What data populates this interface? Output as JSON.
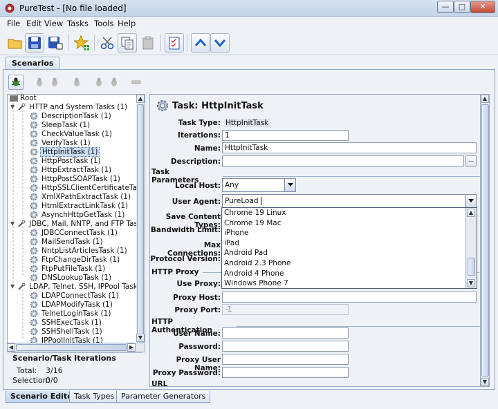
{
  "window": {
    "title": "PureTest - [No file loaded]"
  },
  "menu": [
    "File",
    "Edit",
    "View",
    "Tasks",
    "Tools",
    "Help"
  ],
  "main_tab": "Scenarios",
  "tree": {
    "root": "Root",
    "groups": [
      {
        "label": "HTTP and System Tasks (1)",
        "items": [
          "DescriptionTask (1)",
          "SleepTask (1)",
          "CheckValueTask (1)",
          "VerifyTask (1)",
          "HttpInitTask (1)",
          "HttpPostTask (1)",
          "HttpExtractTask (1)",
          "HttpPostSOAPTask (1)",
          "HttpSSLClientCertificateTask (",
          "XmlXPathExtractTask (1)",
          "HtmlExtractLinkTask (1)",
          "AsynchHttpGetTask (1)"
        ]
      },
      {
        "label": "JDBC, Mail, NNTP, and FTP Tasks",
        "items": [
          "JDBCConnectTask (1)",
          "MailSendTask (1)",
          "NntpListArticlesTask (1)",
          "FtpChangeDirTask (1)",
          "FtpPutFileTask (1)",
          "DNSLookupTask (1)"
        ]
      },
      {
        "label": "LDAP, Telnet, SSH, IPPool Tasks (",
        "items": [
          "LDAPConnectTask (1)",
          "LDAPModifyTask (1)",
          "TelnetLoginTask (1)",
          "SSHExecTask (1)",
          "SSHShellTask (1)",
          "IPPoolInitTask (1)"
        ]
      }
    ],
    "selected": "HttpInitTask (1)"
  },
  "iterations": {
    "header": "Scenario/Task Iterations",
    "total_label": "Total:",
    "total_value": "3/16",
    "selection_label": "Selection:",
    "selection_value": "0/0"
  },
  "task": {
    "header": "Task: HttpInitTask",
    "type_label": "Task Type:",
    "type_value": "HttpInitTask",
    "iterations_label": "Iterations:",
    "iterations_value": "1",
    "name_label": "Name:",
    "name_value": "HttpInitTask",
    "description_label": "Description:",
    "description_value": "",
    "desc_button": "...",
    "params_section": "Task Parameters",
    "local_host_label": "Local Host:",
    "local_host_value": "Any",
    "user_agent_label": "User Agent:",
    "user_agent_value": "PureLoad",
    "save_content_label": "Save Content Types:",
    "bandwidth_label": "Bandwidth Limit:",
    "max_conn_label": "Max Connections:",
    "protocol_label": "Protocol Version:",
    "proxy_section": "HTTP Proxy",
    "use_proxy_label": "Use Proxy:",
    "proxy_host_label": "Proxy Host:",
    "proxy_host_value": "",
    "proxy_port_label": "Proxy Port:",
    "proxy_port_value": "-1",
    "auth_section": "HTTP Authentication",
    "user_name_label": "User Name:",
    "password_label": "Password:",
    "proxy_user_label": "Proxy User Name:",
    "proxy_pass_label": "Proxy Password:",
    "url_section": "URL Rewriting"
  },
  "user_agent_options": [
    "Chrome 19 Linux",
    "Chrome 19 Mac",
    "iPhone",
    "iPad",
    "Android Pad",
    "Android 2.3 Phone",
    "Android 4 Phone",
    "Windows Phone 7"
  ],
  "bottom_tabs": [
    "Scenario Editor",
    "Task Types",
    "Parameter Generators"
  ],
  "colors": {
    "accent": "#2f6fd1",
    "selection": "#c9dcf3"
  }
}
